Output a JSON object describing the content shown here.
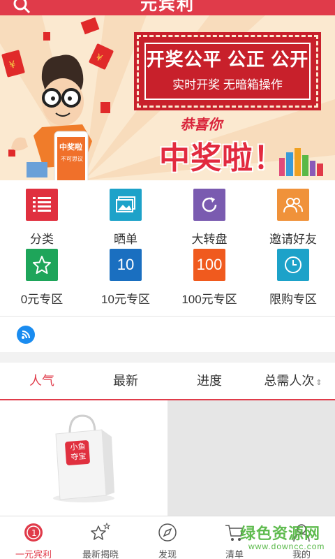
{
  "header": {
    "title": "元宾利"
  },
  "banner": {
    "headline": "开奖公平 公正 公开",
    "subline": "实时开奖 无暗箱操作",
    "congrats": "恭喜你",
    "win": "中奖啦！"
  },
  "categories": [
    {
      "label": "分类",
      "color": "#e0303f",
      "icon": "list-icon"
    },
    {
      "label": "晒单",
      "color": "#1da2c9",
      "icon": "photo-icon"
    },
    {
      "label": "大转盘",
      "color": "#7a5bb0",
      "icon": "refresh-icon"
    },
    {
      "label": "邀请好友",
      "color": "#f0923a",
      "icon": "friends-icon"
    },
    {
      "label": "0元专区",
      "color": "#1ea55a",
      "icon": "star-icon",
      "glyph": ""
    },
    {
      "label": "10元专区",
      "color": "#1a6fc0",
      "icon": "ten-icon",
      "glyph": "10"
    },
    {
      "label": "100元专区",
      "color": "#f05a1e",
      "icon": "hundred-icon",
      "glyph": "100"
    },
    {
      "label": "限购专区",
      "color": "#1da2c9",
      "icon": "clock-icon"
    }
  ],
  "tabs": [
    {
      "label": "人气"
    },
    {
      "label": "最新"
    },
    {
      "label": "进度"
    },
    {
      "label": "总需人次"
    }
  ],
  "product": {
    "bag_text_1": "小鱼",
    "bag_text_2": "夺宝"
  },
  "bottom_nav": [
    {
      "label": "一元宾利",
      "icon": "home-coin-icon"
    },
    {
      "label": "最新揭晓",
      "icon": "stars-icon"
    },
    {
      "label": "发现",
      "icon": "compass-icon"
    },
    {
      "label": "清单",
      "icon": "cart-icon"
    },
    {
      "label": "我的",
      "icon": "user-icon"
    }
  ],
  "watermark": {
    "line1": "绿色资源网",
    "line2": "www.downcc.com"
  }
}
